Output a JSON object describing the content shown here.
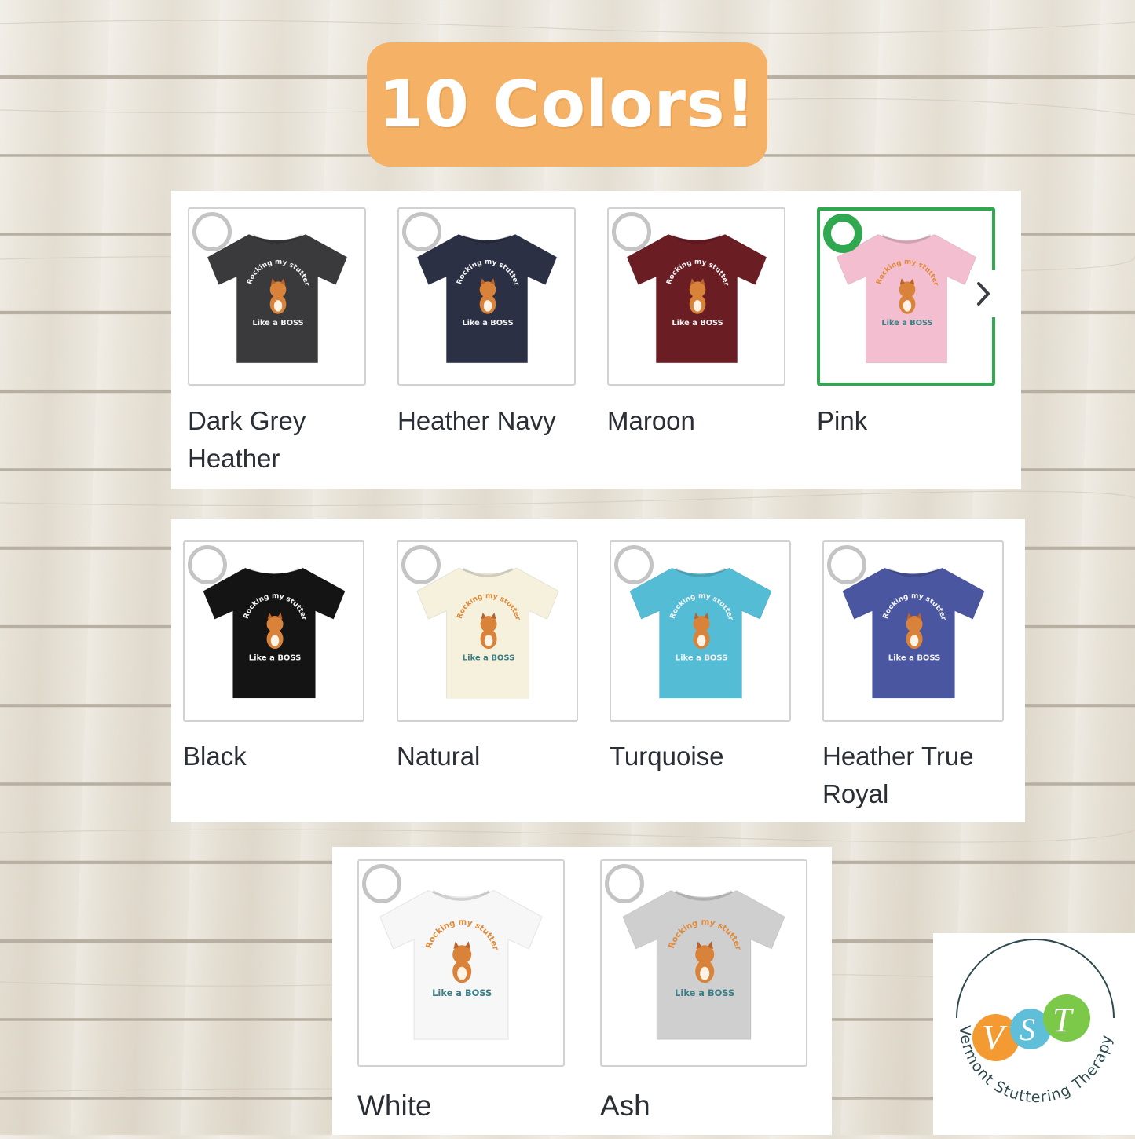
{
  "header": {
    "title": "10 Colors!"
  },
  "colors": {
    "dark_grey_heather": {
      "label": "Dark Grey\nHeather",
      "hex": "#3a3a3c",
      "selected": false
    },
    "heather_navy": {
      "label": "Heather Navy",
      "hex": "#2b3044",
      "selected": false
    },
    "maroon": {
      "label": "Maroon",
      "hex": "#6b1d24",
      "selected": false
    },
    "pink": {
      "label": "Pink",
      "hex": "#f3bfd0",
      "selected": true
    },
    "black": {
      "label": "Black",
      "hex": "#141414",
      "selected": false
    },
    "natural": {
      "label": "Natural",
      "hex": "#f6f1dc",
      "selected": false
    },
    "turquoise": {
      "label": "Turquoise",
      "hex": "#54bcd4",
      "selected": false
    },
    "heather_true_royal": {
      "label": "Heather True\nRoyal",
      "hex": "#4a57a0",
      "selected": false
    },
    "white": {
      "label": "White",
      "hex": "#f7f7f7",
      "selected": false
    },
    "ash": {
      "label": "Ash",
      "hex": "#cfcfcf",
      "selected": false
    }
  },
  "shirt_print": {
    "line1": "Rocking my stutter",
    "line2": "Like a BOSS"
  },
  "logo": {
    "initials": "VST",
    "text": "Vermont Stuttering Therapy"
  },
  "icons": {
    "next": "chevron-right-icon",
    "radio": "radio-circle-icon"
  },
  "accent": {
    "badge": "#f5b266",
    "selected": "#2fa84f"
  }
}
